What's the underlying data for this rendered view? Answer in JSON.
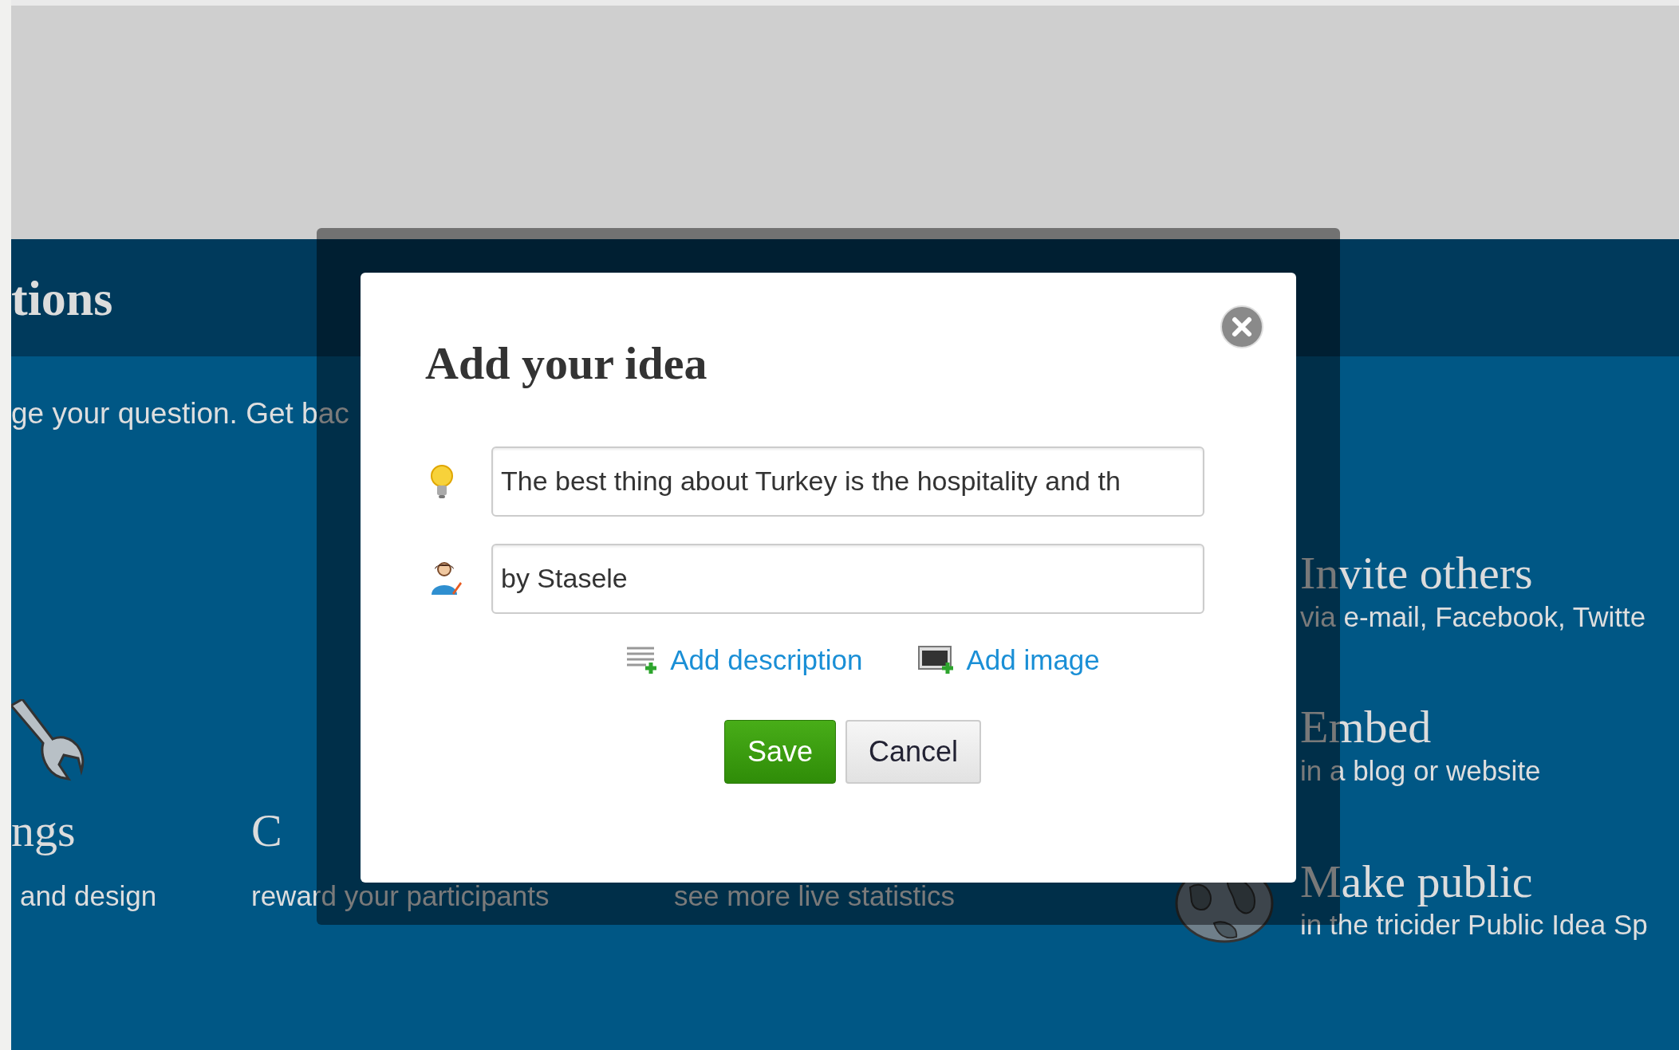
{
  "background": {
    "section_title": "tions",
    "intro": "ge your question. Get bac",
    "features": [
      {
        "title": "ngs",
        "subtitle": "and design"
      },
      {
        "title": "C",
        "subtitle": "reward your participants"
      },
      {
        "subtitle": "see more live statistics"
      }
    ],
    "actions": [
      {
        "title": "Invite others",
        "subtitle": "via e-mail, Facebook, Twitte"
      },
      {
        "title": "Embed",
        "subtitle": "in a blog or website"
      },
      {
        "title": "Make public",
        "subtitle": "in the tricider Public Idea Sp"
      }
    ]
  },
  "dialog": {
    "title": "Add your idea",
    "fields": [
      {
        "kind": "idea",
        "value": "The best thing about Turkey is the hospitality and th"
      },
      {
        "kind": "author",
        "value": "by Stasele"
      }
    ],
    "links": [
      {
        "kind": "description",
        "label": "Add description"
      },
      {
        "kind": "image",
        "label": "Add image"
      }
    ],
    "buttons": [
      {
        "kind": "primary",
        "label": "Save"
      },
      {
        "kind": "secondary",
        "label": "Cancel"
      }
    ]
  }
}
